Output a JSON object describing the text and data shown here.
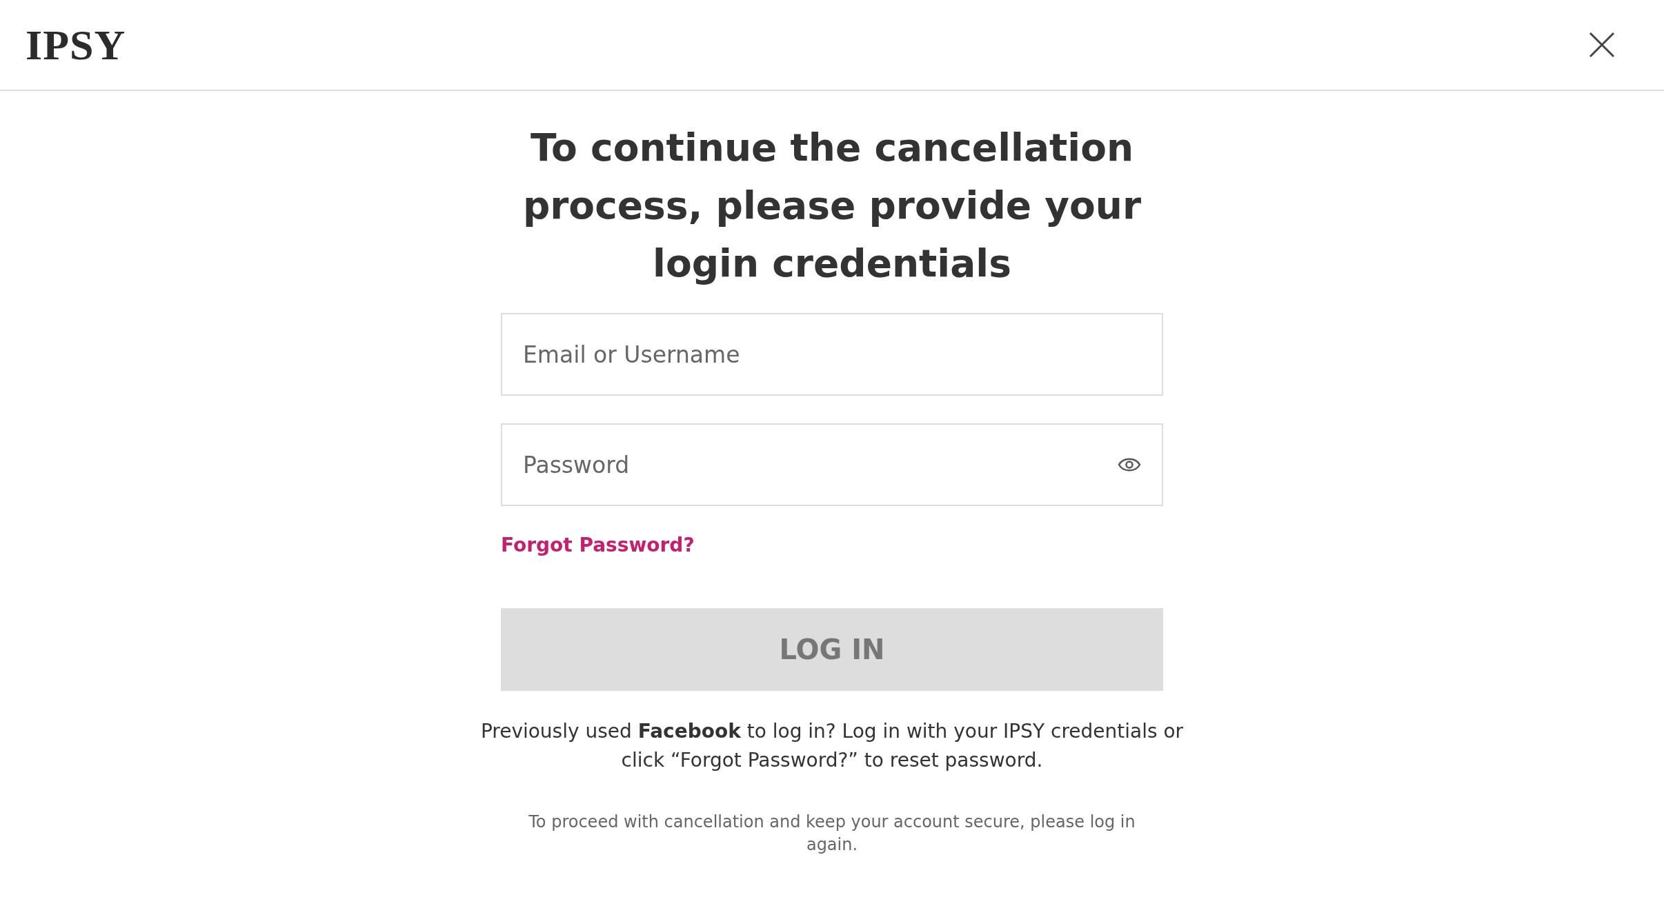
{
  "header": {
    "logo": "IPSY"
  },
  "heading": "To continue the cancellation process, please provide your login credentials",
  "fields": [
    {
      "placeholder": "Email or Username",
      "kind": "text"
    },
    {
      "placeholder": "Password",
      "kind": "password"
    }
  ],
  "forgot_link": "Forgot Password?",
  "login_button": {
    "label": "LOG IN",
    "disabled": true
  },
  "note": "Previously used **Facebook** to log in? Log in with your IPSY credentials or click “Forgot Password?” to reset password.",
  "footer_note": "To proceed with cancellation and keep your account secure, please log in again."
}
